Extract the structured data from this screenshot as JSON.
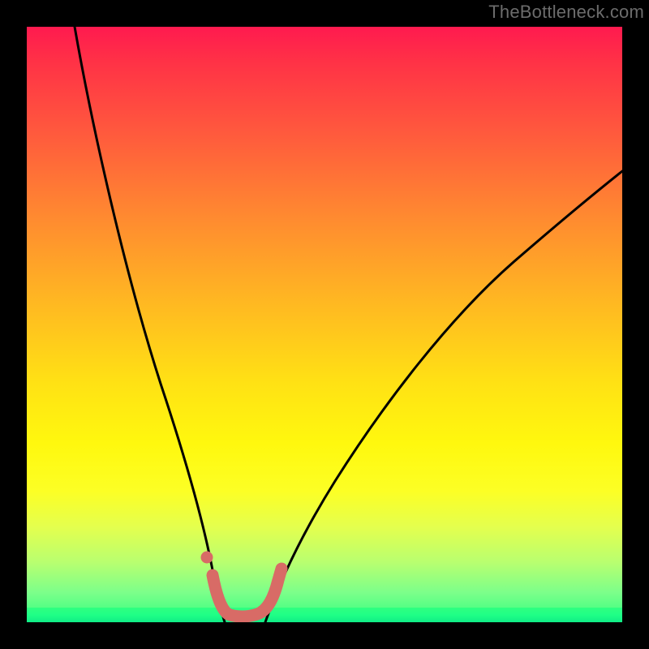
{
  "watermark": "TheBottleneck.com",
  "chart_data": {
    "type": "line",
    "title": "",
    "xlabel": "",
    "ylabel": "",
    "xlim": [
      0,
      1
    ],
    "ylim": [
      0,
      1
    ],
    "series": [
      {
        "name": "left-curve-black",
        "stroke": "#000000",
        "x": [
          0.08,
          0.13,
          0.18,
          0.22,
          0.25,
          0.28,
          0.3,
          0.31,
          0.32,
          0.325
        ],
        "y": [
          1.0,
          0.78,
          0.56,
          0.38,
          0.25,
          0.14,
          0.07,
          0.035,
          0.015,
          0.0
        ]
      },
      {
        "name": "right-curve-black",
        "stroke": "#000000",
        "x": [
          0.4,
          0.42,
          0.46,
          0.52,
          0.6,
          0.7,
          0.8,
          0.9,
          1.0
        ],
        "y": [
          0.0,
          0.04,
          0.12,
          0.23,
          0.37,
          0.51,
          0.62,
          0.71,
          0.78
        ]
      },
      {
        "name": "trough-highlight",
        "stroke": "#d86b66",
        "x": [
          0.3,
          0.315,
          0.33,
          0.35,
          0.37,
          0.39,
          0.41,
          0.425
        ],
        "y": [
          0.075,
          0.03,
          0.012,
          0.008,
          0.008,
          0.012,
          0.035,
          0.085
        ]
      },
      {
        "name": "left-dot",
        "stroke": "#d86b66",
        "x": [
          0.298
        ],
        "y": [
          0.11
        ]
      }
    ]
  }
}
